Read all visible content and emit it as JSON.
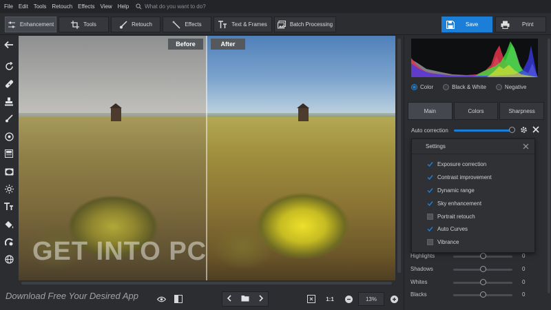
{
  "menubar": {
    "items": [
      "File",
      "Edit",
      "Tools",
      "Retouch",
      "Effects",
      "View",
      "Help"
    ],
    "search_placeholder": "What do you want to do?"
  },
  "toolbar": {
    "tabs": [
      {
        "label": "Enhancement",
        "icon": "sliders-icon",
        "active": true
      },
      {
        "label": "Tools",
        "icon": "crop-icon",
        "active": false
      },
      {
        "label": "Retouch",
        "icon": "brush-icon",
        "active": false
      },
      {
        "label": "Effects",
        "icon": "magic-wand-icon",
        "active": false
      },
      {
        "label": "Text & Frames",
        "icon": "text-icon",
        "active": false
      },
      {
        "label": "Batch Processing",
        "icon": "images-icon",
        "active": false
      }
    ],
    "save_label": "Save",
    "print_label": "Print"
  },
  "left_tools": [
    "back-arrow-icon",
    "rotate-icon",
    "healing-icon",
    "stamp-icon",
    "brush-icon",
    "target-icon",
    "gradient-icon",
    "vignette-icon",
    "light-icon",
    "text-icon",
    "fill-icon",
    "color-splash-icon",
    "globe-icon"
  ],
  "canvas": {
    "before_label": "Before",
    "after_label": "After",
    "watermark": "GET INTO PC"
  },
  "bottom": {
    "watermark": "Download Free Your Desired App",
    "zoom_label": "1:1",
    "zoom_value": "13%"
  },
  "panel": {
    "modes": [
      {
        "label": "Color",
        "selected": true
      },
      {
        "label": "Black & White",
        "selected": false
      },
      {
        "label": "Negative",
        "selected": false
      }
    ],
    "tabs": [
      {
        "label": "Main",
        "active": true
      },
      {
        "label": "Colors",
        "active": false
      },
      {
        "label": "Sharpness",
        "active": false
      }
    ],
    "auto_correction_label": "Auto correction",
    "settings": {
      "title": "Settings",
      "items": [
        {
          "label": "Exposure correction",
          "checked": true
        },
        {
          "label": "Contrast improvement",
          "checked": true
        },
        {
          "label": "Dynamic range",
          "checked": true
        },
        {
          "label": "Sky enhancement",
          "checked": true
        },
        {
          "label": "Portrait retouch",
          "checked": false
        },
        {
          "label": "Auto Curves",
          "checked": true
        },
        {
          "label": "Vibrance",
          "checked": false
        }
      ]
    },
    "adjustments": [
      {
        "label": "Highlights",
        "value": "0"
      },
      {
        "label": "Shadows",
        "value": "0"
      },
      {
        "label": "Whites",
        "value": "0"
      },
      {
        "label": "Blacks",
        "value": "0"
      }
    ]
  },
  "colors": {
    "accent": "#1b7fd8",
    "bg": "#2b2d31"
  }
}
